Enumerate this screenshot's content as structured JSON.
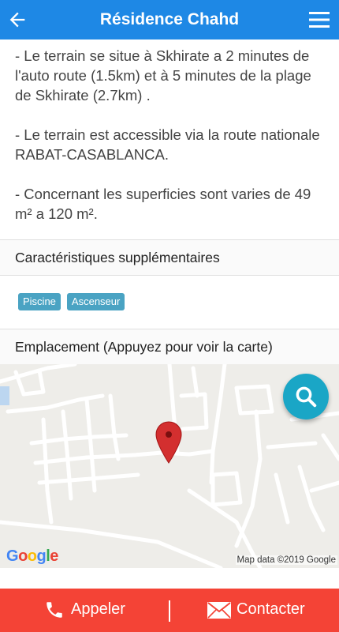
{
  "appbar": {
    "title": "Résidence Chahd",
    "back_icon": "arrow-left-icon",
    "menu_icon": "hamburger-menu-icon"
  },
  "description": {
    "paragraphs": [
      "- Le terrain se situe à Skhirate a 2 minutes de l'auto route (1.5km) et à 5 minutes de la plage de Skhirate (2.7km) .",
      "- Le terrain est accessible via la route nationale RABAT-CASABLANCA.",
      "- Concernant les superficies sont varies de 49 m² a 120 m²."
    ]
  },
  "features": {
    "heading": "Caractéristiques supplémentaires",
    "tags": [
      "Piscine",
      "Ascenseur"
    ]
  },
  "location": {
    "heading": "Emplacement (Appuyez pour voir la carte)",
    "map_logo": "Google",
    "map_attribution": "Map data ©2019 Google",
    "pin_color": "#d32f2f",
    "fab_icon": "search-icon"
  },
  "actions": {
    "call_label": "Appeler",
    "contact_label": "Contacter",
    "call_icon": "phone-icon",
    "contact_icon": "envelope-icon"
  },
  "colors": {
    "appbar": "#1e88e5",
    "action_bar": "#f44336",
    "tag": "#4aa3c3",
    "fab": "#1aa6c6"
  }
}
